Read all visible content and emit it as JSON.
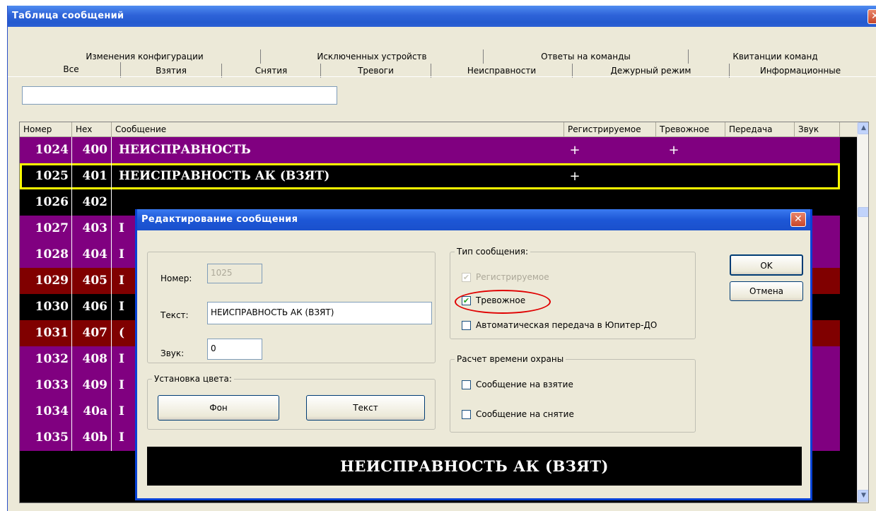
{
  "window": {
    "title": "Таблица сообщений",
    "close_glyph": "✕"
  },
  "tabs_row1": [
    "Изменения конфигурации",
    "Исключенных устройств",
    "Ответы на команды",
    "Квитанции команд"
  ],
  "tabs_row2": [
    "Все",
    "Взятия",
    "Снятия",
    "Тревоги",
    "Неисправности",
    "Дежурный режим",
    "Информационные"
  ],
  "filter": {
    "value": ""
  },
  "columns": [
    "Номер",
    "Hex",
    "Сообщение",
    "Регистрируемое",
    "Тревожное",
    "Передача",
    "Звук"
  ],
  "rows": [
    {
      "num": "1024",
      "hex": "400",
      "msg": "НЕИСПРАВНОСТЬ",
      "reg": "+",
      "alarm": "+",
      "color": "#800080"
    },
    {
      "num": "1025",
      "hex": "401",
      "msg": "НЕИСПРАВНОСТЬ АК (ВЗЯТ)",
      "reg": "+",
      "alarm": "",
      "color": "#000000"
    },
    {
      "num": "1026",
      "hex": "402",
      "msg": "",
      "reg": "",
      "alarm": "",
      "color": "#000000"
    },
    {
      "num": "1027",
      "hex": "403",
      "msg": "I",
      "reg": "",
      "alarm": "",
      "color": "#800080"
    },
    {
      "num": "1028",
      "hex": "404",
      "msg": "I",
      "reg": "",
      "alarm": "",
      "color": "#800080"
    },
    {
      "num": "1029",
      "hex": "405",
      "msg": "I",
      "reg": "",
      "alarm": "",
      "color": "#800000"
    },
    {
      "num": "1030",
      "hex": "406",
      "msg": "I",
      "reg": "",
      "alarm": "",
      "color": "#000000"
    },
    {
      "num": "1031",
      "hex": "407",
      "msg": "(",
      "reg": "",
      "alarm": "",
      "color": "#800000"
    },
    {
      "num": "1032",
      "hex": "408",
      "msg": "I",
      "reg": "",
      "alarm": "",
      "color": "#800080"
    },
    {
      "num": "1033",
      "hex": "409",
      "msg": "I",
      "reg": "",
      "alarm": "",
      "color": "#800080"
    },
    {
      "num": "1034",
      "hex": "40a",
      "msg": "I",
      "reg": "",
      "alarm": "",
      "color": "#800080"
    },
    {
      "num": "1035",
      "hex": "40b",
      "msg": "I",
      "reg": "",
      "alarm": "",
      "color": "#800080"
    }
  ],
  "selected_row": "1025",
  "dialog": {
    "title": "Редактирование сообщения",
    "close_glyph": "✕",
    "number_label": "Номер:",
    "number_value": "1025",
    "text_label": "Текст:",
    "text_value": "НЕИСПРАВНОСТЬ АК (ВЗЯТ)",
    "sound_label": "Звук:",
    "sound_value": "0",
    "color_group": "Установка цвета:",
    "bg_button": "Фон",
    "text_button": "Текст",
    "type_group": "Тип сообщения:",
    "registered": {
      "label": "Регистрируемое",
      "checked": true,
      "disabled": true
    },
    "alarm": {
      "label": "Тревожное",
      "checked": true
    },
    "auto_transfer": {
      "label": "Автоматическая передача в Юпитер-ДО",
      "checked": false
    },
    "guard_group": "Расчет времени охраны",
    "arm_msg": {
      "label": "Сообщение на взятие",
      "checked": false
    },
    "disarm_msg": {
      "label": "Сообщение на снятие",
      "checked": false
    },
    "ok_button": "OK",
    "cancel_button": "Отмена",
    "preview_text": "НЕИСПРАВНОСТЬ АК (ВЗЯТ)"
  },
  "colors": {
    "purple": "#800080",
    "maroon": "#800000",
    "black": "#000000",
    "highlight": "#ffff00",
    "annotation": "#e00000"
  },
  "scroll": {
    "up_icon": "▲",
    "down_icon": "▼"
  },
  "checkmark": "✔"
}
